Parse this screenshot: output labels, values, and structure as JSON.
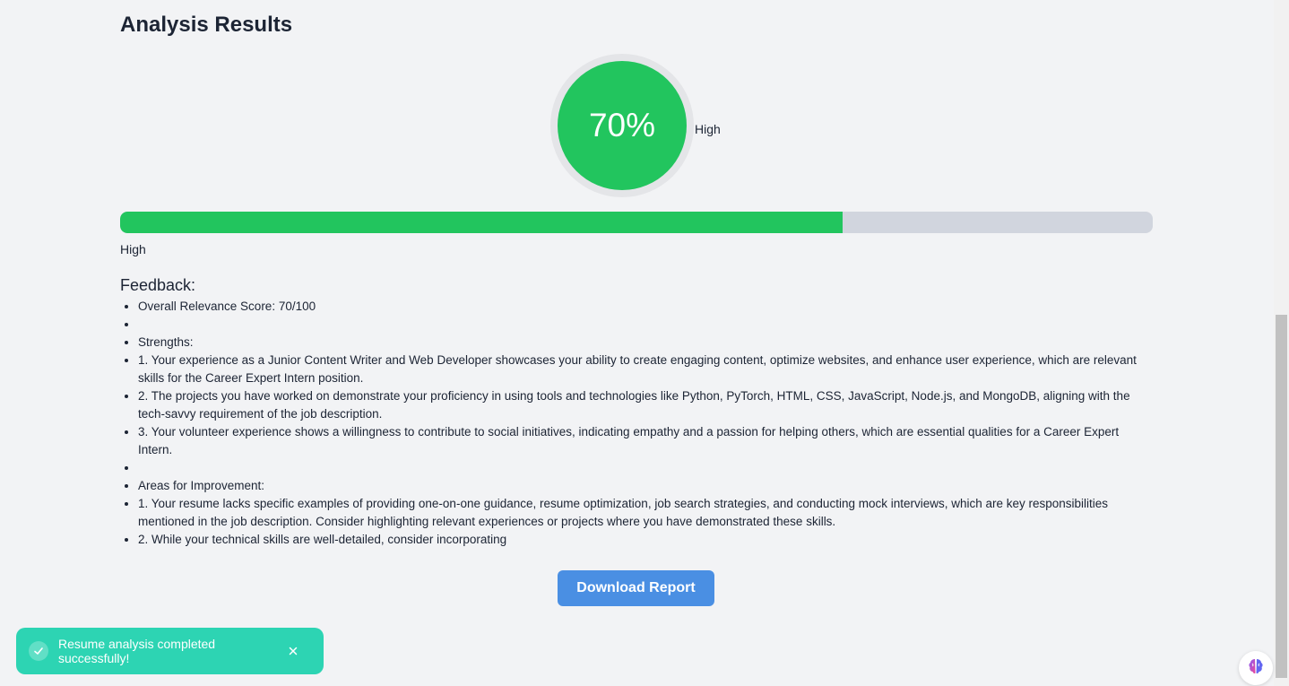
{
  "header": {
    "title": "Analysis Results"
  },
  "score": {
    "percent_label": "70%",
    "level_label": "High",
    "progress_fraction": 0.7,
    "progress_label": "High",
    "accent_color": "#22c55e"
  },
  "feedback": {
    "heading": "Feedback:",
    "items": [
      "Overall Relevance Score: 70/100",
      "",
      "Strengths:",
      "1. Your experience as a Junior Content Writer and Web Developer showcases your ability to create engaging content, optimize websites, and enhance user experience, which are relevant skills for the Career Expert Intern position.",
      "2. The projects you have worked on demonstrate your proficiency in using tools and technologies like Python, PyTorch, HTML, CSS, JavaScript, Node.js, and MongoDB, aligning with the tech-savvy requirement of the job description.",
      "3. Your volunteer experience shows a willingness to contribute to social initiatives, indicating empathy and a passion for helping others, which are essential qualities for a Career Expert Intern.",
      "",
      "Areas for Improvement:",
      "1. Your resume lacks specific examples of providing one-on-one guidance, resume optimization, job search strategies, and conducting mock interviews, which are key responsibilities mentioned in the job description. Consider highlighting relevant experiences or projects where you have demonstrated these skills.",
      "2. While your technical skills are well-detailed, consider incorporating"
    ]
  },
  "actions": {
    "download_label": "Download Report"
  },
  "toast": {
    "message": "Resume analysis completed successfully!",
    "icon": "check-icon",
    "close_icon": "close-icon",
    "color": "#2dd4b3"
  },
  "assistant": {
    "icon": "brain-icon"
  }
}
